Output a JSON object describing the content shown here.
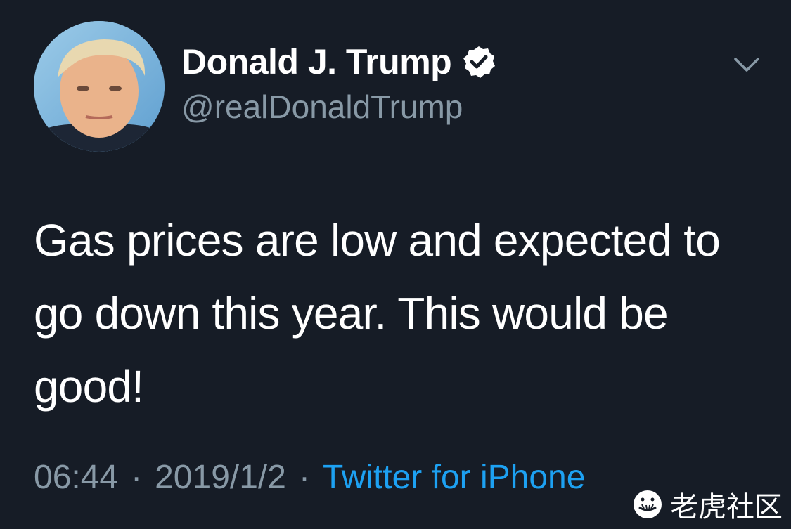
{
  "tweet": {
    "author": {
      "display_name": "Donald J. Trump",
      "handle": "@realDonaldTrump",
      "verified": true
    },
    "text": "Gas prices are low and expected to go down this year. This would be good!",
    "time": "06:44",
    "separator": "·",
    "date": "2019/1/2",
    "source": "Twitter for iPhone"
  },
  "watermark": {
    "text": "老虎社区"
  },
  "colors": {
    "background": "#161c26",
    "text_primary": "#ffffff",
    "text_secondary": "#8899a6",
    "link": "#1da1f2"
  },
  "icons": {
    "verified": "verified-badge-icon",
    "menu": "chevron-down-icon",
    "watermark_logo": "tiger-logo-icon"
  }
}
